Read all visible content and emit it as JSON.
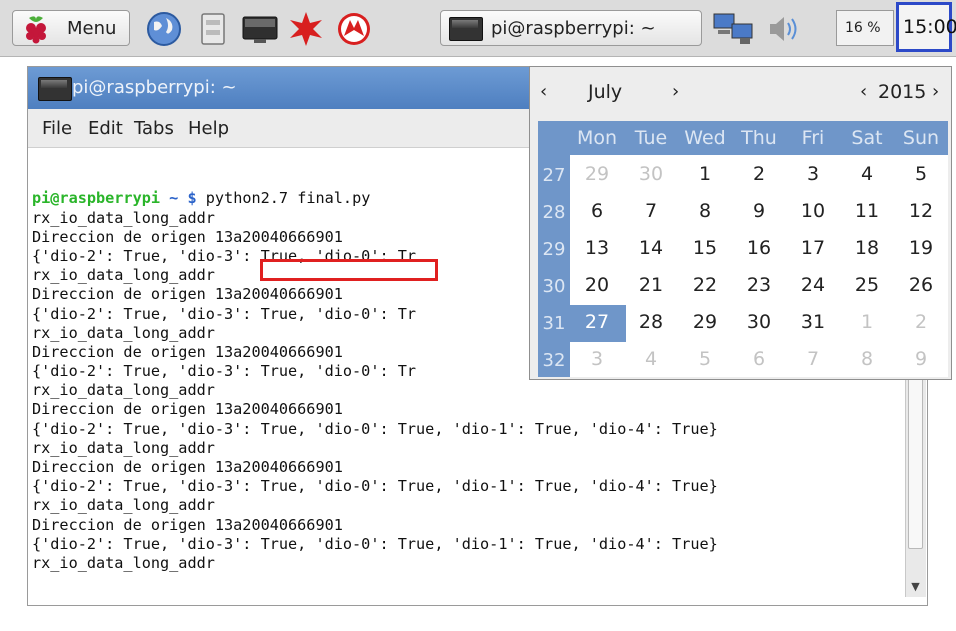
{
  "taskbar": {
    "menu_label": "Menu",
    "launchers": [
      "web-browser-icon",
      "file-manager-icon",
      "terminal-icon",
      "mathematica-icon",
      "wolfram-icon"
    ],
    "window_button_label": "pi@raspberrypi: ~",
    "cpu_label": "16 %",
    "clock": "15:00"
  },
  "terminal": {
    "title": "pi@raspberrypi: ~",
    "menu": [
      "File",
      "Edit",
      "Tabs",
      "Help"
    ],
    "prompt_user": "pi@raspberrypi",
    "prompt_dir": "~ $",
    "command": "python2.7 final.py",
    "lines": [
      "rx_io_data_long_addr",
      "Direccion de origen 13a20040666901",
      "{'dio-2': True, 'dio-3': True, 'dio-0': Tr",
      "rx_io_data_long_addr",
      "Direccion de origen 13a20040666901",
      "{'dio-2': True, 'dio-3': True, 'dio-0': Tr",
      "rx_io_data_long_addr",
      "Direccion de origen 13a20040666901",
      "{'dio-2': True, 'dio-3': True, 'dio-0': Tr",
      "rx_io_data_long_addr",
      "Direccion de origen 13a20040666901",
      "{'dio-2': True, 'dio-3': True, 'dio-0': True, 'dio-1': True, 'dio-4': True}",
      "rx_io_data_long_addr",
      "Direccion de origen 13a20040666901",
      "{'dio-2': True, 'dio-3': True, 'dio-0': True, 'dio-1': True, 'dio-4': True}",
      "rx_io_data_long_addr",
      "Direccion de origen 13a20040666901",
      "{'dio-2': True, 'dio-3': True, 'dio-0': True, 'dio-1': True, 'dio-4': True}",
      "rx_io_data_long_addr"
    ]
  },
  "calendar": {
    "prev_month": "‹",
    "month": "July",
    "next_month": "›",
    "prev_year": "‹",
    "year": "2015",
    "next_year": "›",
    "days_header": [
      "Mon",
      "Tue",
      "Wed",
      "Thu",
      "Fri",
      "Sat",
      "Sun"
    ],
    "week_numbers": [
      "27",
      "28",
      "29",
      "30",
      "31",
      "32"
    ],
    "weeks": [
      [
        "29",
        "30",
        "1",
        "2",
        "3",
        "4",
        "5"
      ],
      [
        "6",
        "7",
        "8",
        "9",
        "10",
        "11",
        "12"
      ],
      [
        "13",
        "14",
        "15",
        "16",
        "17",
        "18",
        "19"
      ],
      [
        "20",
        "21",
        "22",
        "23",
        "24",
        "25",
        "26"
      ],
      [
        "27",
        "28",
        "29",
        "30",
        "31",
        "1",
        "2"
      ],
      [
        "3",
        "4",
        "5",
        "6",
        "7",
        "8",
        "9"
      ]
    ],
    "selected_day": "27"
  },
  "colors": {
    "title_bar": "#5a88c6",
    "calendar_accent": "#6f96c9",
    "highlight_box": "#e02020",
    "clock_outline": "#2c49c8",
    "prompt_user": "#2ab52a",
    "prompt_dir": "#2a62c9"
  }
}
